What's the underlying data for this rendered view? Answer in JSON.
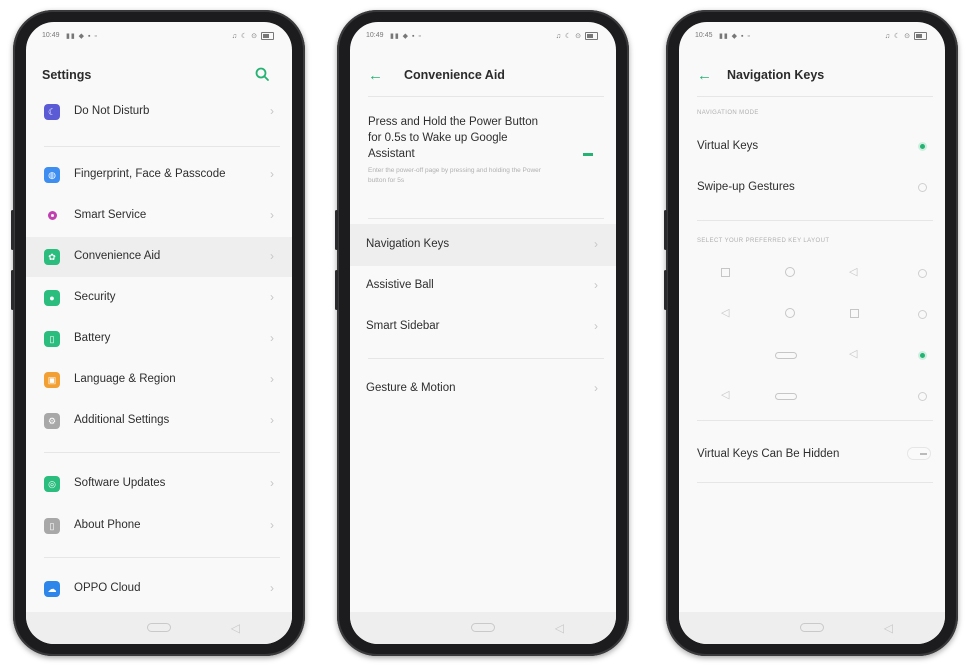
{
  "status": {
    "time_1": "10:49",
    "time_2": "10:49",
    "time_3": "10:45"
  },
  "screen1": {
    "title": "Settings",
    "items": [
      {
        "label": "Do Not Disturb",
        "icon": "moon-icon",
        "color": "#5b5bd6"
      },
      {
        "label": "Fingerprint, Face & Passcode",
        "icon": "fingerprint-icon",
        "color": "#3d8ef0"
      },
      {
        "label": "Smart Service",
        "icon": "smart-service-icon",
        "color": "#c23fb2"
      },
      {
        "label": "Convenience Aid",
        "icon": "convenience-icon",
        "color": "#2bbd7e"
      },
      {
        "label": "Security",
        "icon": "shield-icon",
        "color": "#2bbd7e"
      },
      {
        "label": "Battery",
        "icon": "battery-icon",
        "color": "#2bbd7e"
      },
      {
        "label": "Language & Region",
        "icon": "globe-icon",
        "color": "#f2a033"
      },
      {
        "label": "Additional Settings",
        "icon": "gear-icon",
        "color": "#a8a8a8"
      },
      {
        "label": "Software Updates",
        "icon": "update-icon",
        "color": "#2bbd7e"
      },
      {
        "label": "About Phone",
        "icon": "info-icon",
        "color": "#a8a8a8"
      },
      {
        "label": "OPPO Cloud",
        "icon": "cloud-icon",
        "color": "#2e86ea"
      }
    ]
  },
  "screen2": {
    "title": "Convenience Aid",
    "power_title": "Press and Hold the Power Button for 0.5s to Wake up Google Assistant",
    "power_desc": "Enter the power-off page by pressing and holding the Power button for 5s",
    "items": [
      {
        "label": "Navigation Keys"
      },
      {
        "label": "Assistive Ball"
      },
      {
        "label": "Smart Sidebar"
      },
      {
        "label": "Gesture & Motion"
      }
    ]
  },
  "screen3": {
    "title": "Navigation Keys",
    "mode_header": "NAVIGATION MODE",
    "virtual_keys": "Virtual Keys",
    "swipe_up": "Swipe-up Gestures",
    "layout_header": "SELECT YOUR PREFERRED KEY LAYOUT",
    "can_be_hidden": "Virtual Keys Can Be Hidden"
  },
  "colors": {
    "accent": "#24b373"
  }
}
